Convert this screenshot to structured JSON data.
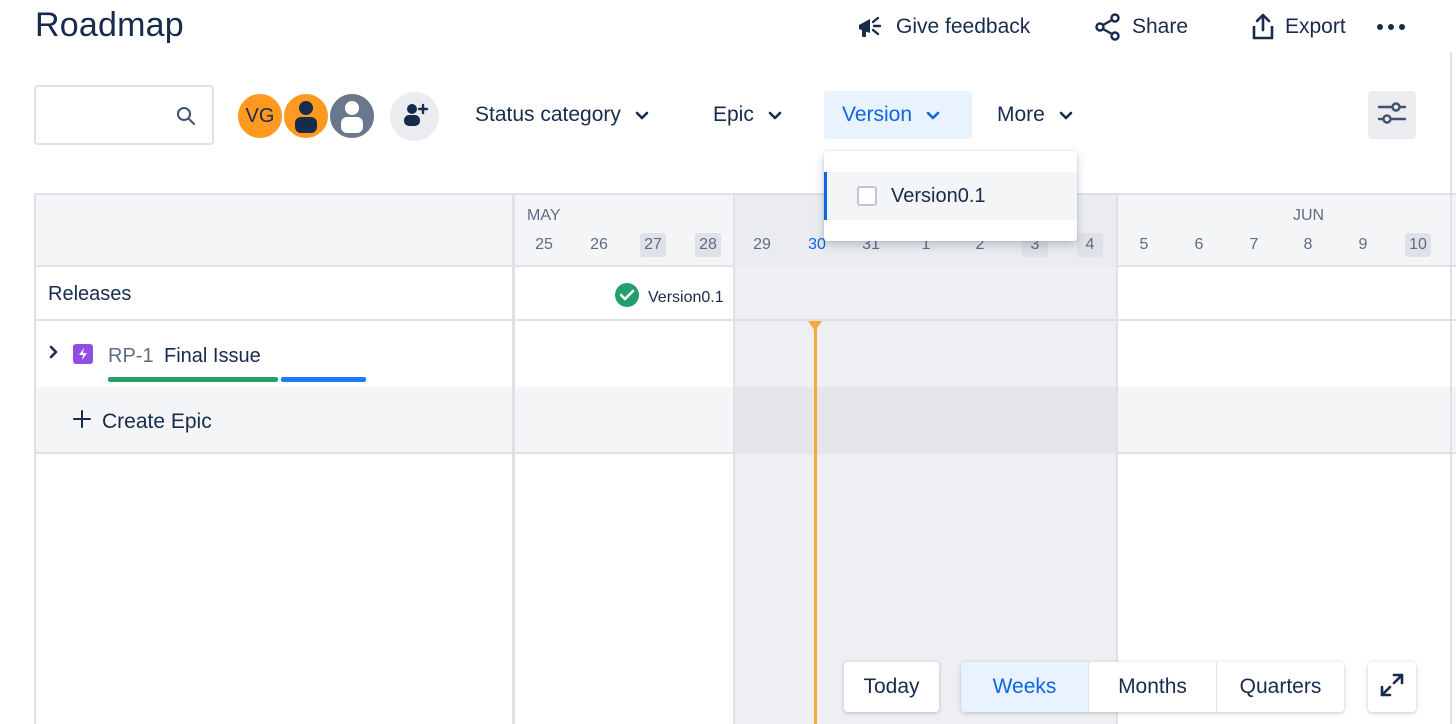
{
  "header": {
    "title": "Roadmap",
    "actions": {
      "feedback": "Give feedback",
      "share": "Share",
      "export": "Export"
    }
  },
  "toolbar": {
    "search": {
      "value": "",
      "placeholder": ""
    },
    "avatars": [
      "VG"
    ],
    "filters": {
      "status": "Status category",
      "epic": "Epic",
      "version": "Version",
      "more": "More"
    }
  },
  "version_dropdown": {
    "options": [
      "Version0.1"
    ]
  },
  "timeline": {
    "month_may": "MAY",
    "month_jun": "JUN",
    "days": [
      "25",
      "26",
      "27",
      "28",
      "29",
      "30",
      "31",
      "1",
      "2",
      "3",
      "4",
      "5",
      "6",
      "7",
      "8",
      "9",
      "10"
    ]
  },
  "releases": {
    "label": "Releases",
    "version": "Version0.1"
  },
  "epic": {
    "key": "RP-1",
    "summary": "Final Issue",
    "progress_done": 0.66,
    "progress_in_progress": 0.34
  },
  "create_epic": "Create Epic",
  "controls": {
    "today": "Today",
    "weeks": "Weeks",
    "months": "Months",
    "quarters": "Quarters"
  },
  "colors": {
    "accent": "#0c66e4",
    "today_line": "#f6a93b",
    "epic_purple": "#904ee2",
    "done_green": "#22a06b"
  }
}
